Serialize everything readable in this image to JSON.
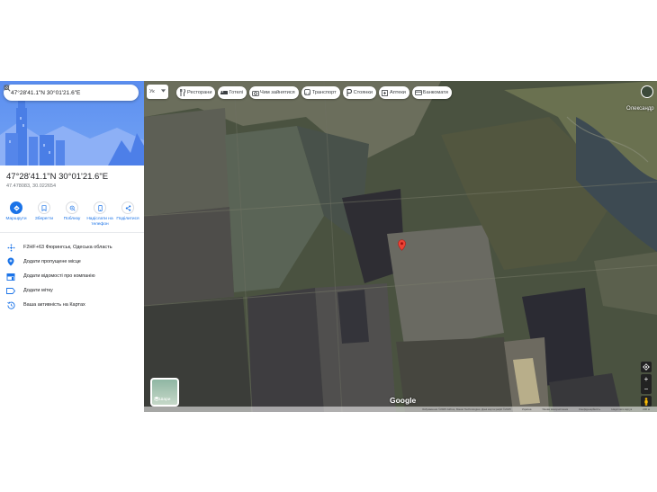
{
  "search": {
    "value": "47°28'41.1\"N 30°01'21.6\"E"
  },
  "place": {
    "title": "47°28'41.1\"N 30°01'21.6\"E",
    "coords_decimal": "47.478083, 30.022654"
  },
  "actions": [
    {
      "label": "Маршрути",
      "icon": "directions-icon"
    },
    {
      "label": "Зберегти",
      "icon": "bookmark-icon"
    },
    {
      "label": "Поблизу",
      "icon": "nearby-icon"
    },
    {
      "label": "Надіслати на телефон",
      "icon": "send-to-phone-icon"
    },
    {
      "label": "Поділитися",
      "icon": "share-icon"
    }
  ],
  "info": [
    {
      "text": "F2HF+63 Фюрингськ, Одеська область",
      "icon": "plus-code-icon"
    },
    {
      "text": "Додати пропущене місце",
      "icon": "add-place-icon"
    },
    {
      "text": "Додати відомості про компанію",
      "icon": "business-icon"
    },
    {
      "text": "Додати мітку",
      "icon": "label-icon"
    },
    {
      "text": "Ваша активність на Картах",
      "icon": "history-icon"
    }
  ],
  "map": {
    "lang": "Ук",
    "chips": [
      {
        "label": "Ресторани",
        "icon": "restaurant-icon"
      },
      {
        "label": "Готелі",
        "icon": "hotel-icon"
      },
      {
        "label": "Чим зайнятися",
        "icon": "camera-icon"
      },
      {
        "label": "Транспорт",
        "icon": "transit-icon"
      },
      {
        "label": "Стоянки",
        "icon": "parking-icon"
      },
      {
        "label": "Аптеки",
        "icon": "pharmacy-icon"
      },
      {
        "label": "Банкомати",
        "icon": "atm-icon"
      }
    ],
    "town": "Олександр",
    "layers_label": "Шари",
    "logo": "Google",
    "footer": [
      "Зображення ©2025 Airbus, Maxar Technologies, Дані картографії ©2025",
      "Україна",
      "Умови використання",
      "Конфіденційність",
      "Надіслати відгук",
      "200 м"
    ],
    "pin_color": "#ea4335"
  },
  "colors": {
    "accent": "#1a73e8"
  }
}
